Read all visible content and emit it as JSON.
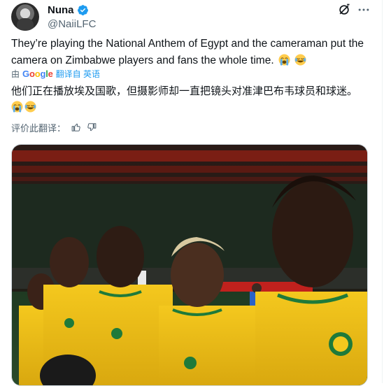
{
  "author": {
    "display_name": "Nuna",
    "handle": "@NaiiLFC",
    "verified": true
  },
  "icons": {
    "verified": "verified-badge-icon",
    "grok": "grok-icon",
    "more": "more-options-icon",
    "emoji_1": "loudly-crying-face-emoji",
    "emoji_2": "face-with-tears-of-joy-emoji",
    "thumbs_up": "thumbs-up-icon",
    "thumbs_down": "thumbs-down-icon"
  },
  "tweet": {
    "text": "They’re playing the National Anthem of Egypt and the cameraman put the camera on Zimbabwe players and fans the whole time."
  },
  "translation": {
    "by_label": "由",
    "provider": "Google",
    "link_label": "翻译自 英语",
    "translated_text": "他们正在播放埃及国歌，但摄影师却一直把镜头对准津巴布韦球员和球迷。",
    "rate_label": "评价此翻译："
  },
  "media": {
    "description_alt": "image"
  },
  "colors": {
    "accent": "#1d9bf0",
    "text_primary": "#0f1419",
    "text_secondary": "#536471",
    "jersey_yellow": "#f2c21a",
    "jersey_green": "#1f7a3a"
  }
}
